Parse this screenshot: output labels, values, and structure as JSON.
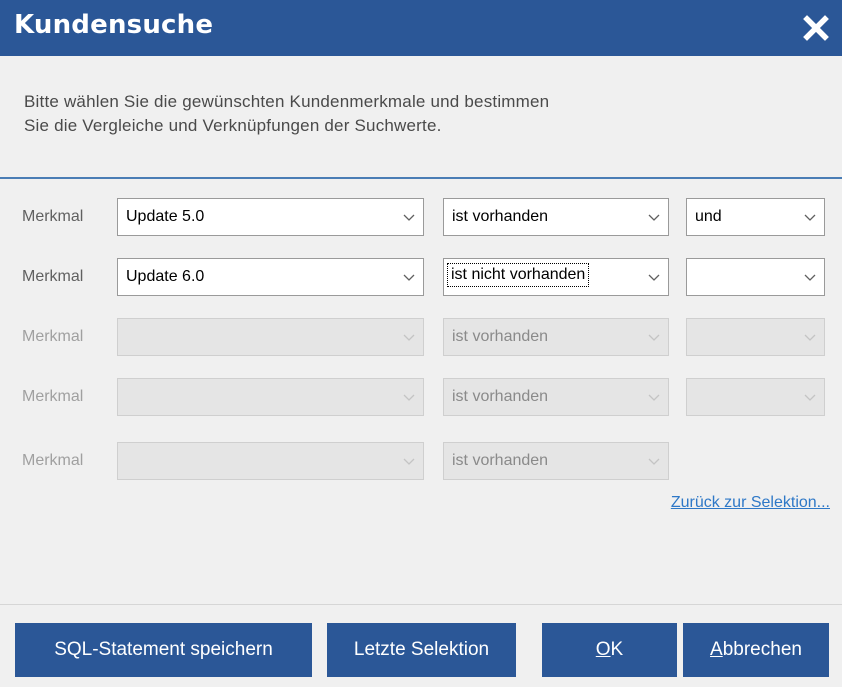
{
  "window": {
    "title": "Kundensuche"
  },
  "intro": {
    "line1": "Bitte wählen Sie die gewünschten Kundenmerkmale und bestimmen",
    "line2": "Sie die Vergleiche und Verknüpfungen der Suchwerte."
  },
  "rows": [
    {
      "label": "Merkmal",
      "merkmal": "Update 5.0",
      "vergleich": "ist vorhanden",
      "verknuepfung": "und",
      "enabled": true
    },
    {
      "label": "Merkmal",
      "merkmal": "Update 6.0",
      "vergleich": "ist nicht vorhanden",
      "verknuepfung": "",
      "enabled": true
    },
    {
      "label": "Merkmal",
      "merkmal": "",
      "vergleich": "ist vorhanden",
      "verknuepfung": "",
      "enabled": false
    },
    {
      "label": "Merkmal",
      "merkmal": "",
      "vergleich": "ist vorhanden",
      "verknuepfung": "",
      "enabled": false
    },
    {
      "label": "Merkmal",
      "merkmal": "",
      "vergleich": "ist vorhanden",
      "enabled": false
    }
  ],
  "link": {
    "back_label": "Zurück zur Selektion..."
  },
  "buttons": {
    "sql_label": "SQL-Statement speichern",
    "last_label": "Letzte Selektion",
    "ok_accel": "O",
    "ok_rest": "K",
    "cancel_accel": "A",
    "cancel_rest": "bbrechen"
  },
  "colors": {
    "titlebar": "#2b5797",
    "button": "#2b5797",
    "link": "#2e78c7"
  },
  "icons": {
    "close": "close-icon",
    "dropdown": "chevron-down-icon"
  }
}
